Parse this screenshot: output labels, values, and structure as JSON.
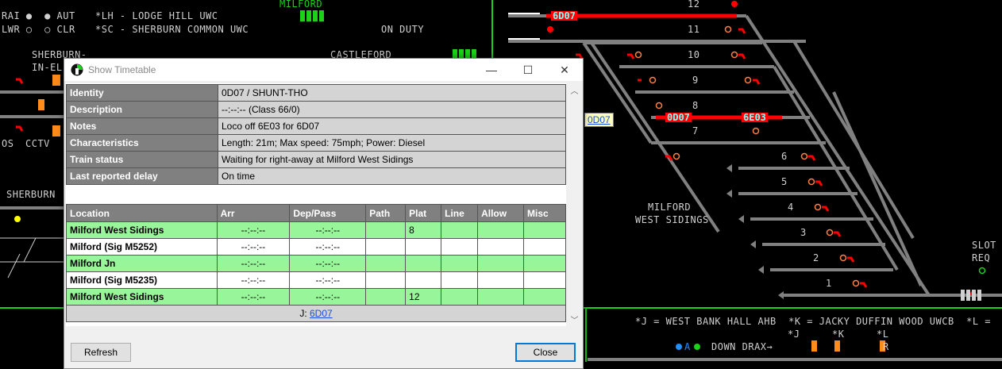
{
  "schematic": {
    "legend": {
      "rai": "RAI",
      "aut": "AUT",
      "lwr": "LWR",
      "clr": "CLR",
      "lh": "*LH - LODGE HILL UWC",
      "sc": "*SC - SHERBURN COMMON UWC"
    },
    "labels": {
      "milford": "MILFORD",
      "on_duty": "ON DUTY",
      "castleford": "CASTLEFORD",
      "sherburn_in_elmet_1": "SHERBURN-",
      "sherburn_in_elmet_2": "IN-EL",
      "os": "OS",
      "cctv": "CCTV",
      "sherburn": "SHERBURN",
      "milford_west_sidings_1": "MILFORD",
      "milford_west_sidings_2": "WEST SIDINGS",
      "slot_req_1": "SLOT",
      "slot_req_2": "REQ",
      "bottom_key": "*J = WEST BANK HALL AHB  *K = JACKY DUFFIN WOOD UWCB  *L =",
      "down_drax": "DOWN DRAX",
      "a": "A",
      "j": "*J",
      "k": "*K",
      "l": "*L",
      "r": "R"
    },
    "road_numbers": [
      "12",
      "11",
      "10",
      "9",
      "8",
      "7",
      "6",
      "5",
      "4",
      "3",
      "2",
      "1"
    ],
    "train_tags": {
      "t1": "6D07",
      "t2": "0D07",
      "t3": "6E03"
    },
    "tooltip": "0D07"
  },
  "dialog": {
    "title": "Show Timetable",
    "controls": {
      "minimize": "—",
      "maximize": "☐",
      "close": "✕"
    },
    "info": [
      {
        "key": "Identity",
        "value": "0D07 / SHUNT-THO"
      },
      {
        "key": "Description",
        "value": "--:--:-- (Class 66/0)"
      },
      {
        "key": "Notes",
        "value": "Loco off 6E03 for 6D07"
      },
      {
        "key": "Characteristics",
        "value": "Length: 21m; Max speed: 75mph; Power: Diesel"
      },
      {
        "key": "Train status",
        "value": "Waiting for right-away at Milford West Sidings"
      },
      {
        "key": "Last reported delay",
        "value": "On time"
      }
    ],
    "columns": [
      "Location",
      "Arr",
      "Dep/Pass",
      "Path",
      "Plat",
      "Line",
      "Allow",
      "Misc"
    ],
    "rows": [
      {
        "location": "Milford West Sidings",
        "arr": "--:--:--",
        "dep": "--:--:--",
        "path": "",
        "plat": "8",
        "line": "",
        "allow": "",
        "misc": ""
      },
      {
        "location": "Milford (Sig M5252)",
        "arr": "--:--:--",
        "dep": "--:--:--",
        "path": "",
        "plat": "",
        "line": "",
        "allow": "",
        "misc": ""
      },
      {
        "location": "Milford Jn",
        "arr": "--:--:--",
        "dep": "--:--:--",
        "path": "",
        "plat": "",
        "line": "",
        "allow": "",
        "misc": ""
      },
      {
        "location": "Milford (Sig M5235)",
        "arr": "--:--:--",
        "dep": "--:--:--",
        "path": "",
        "plat": "",
        "line": "",
        "allow": "",
        "misc": ""
      },
      {
        "location": "Milford West Sidings",
        "arr": "--:--:--",
        "dep": "--:--:--",
        "path": "",
        "plat": "12",
        "line": "",
        "allow": "",
        "misc": ""
      }
    ],
    "footer_prefix": "J: ",
    "footer_link": "6D07",
    "refresh_label": "Refresh",
    "close_label": "Close"
  },
  "colors": {
    "track": "#808080",
    "route_set": "#ff0000",
    "platform_green": "#19d219",
    "row_green": "#99f599",
    "signal_red": "#ff0000",
    "signal_ring": "#ff8040",
    "train_id": "#7fffff"
  }
}
